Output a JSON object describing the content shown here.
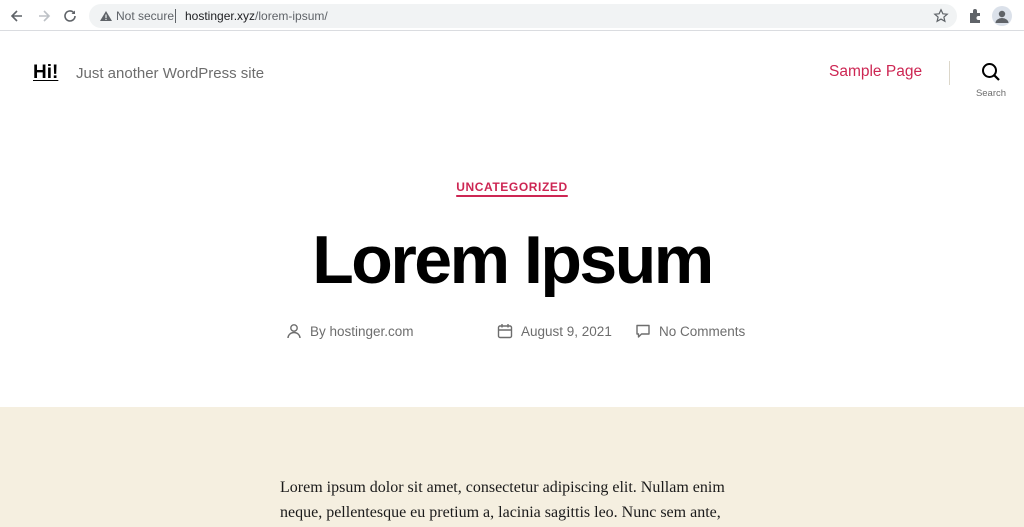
{
  "browser": {
    "security_label": "Not secure",
    "url_host": "hostinger.xyz",
    "url_path": "/lorem-ipsum/",
    "icons": [
      "back-icon",
      "forward-icon",
      "reload-icon",
      "warning-icon",
      "star-icon",
      "extensions-icon",
      "profile-icon"
    ]
  },
  "site": {
    "title": "Hi!",
    "tagline": "Just another WordPress site",
    "nav": [
      {
        "label": "Sample Page"
      }
    ],
    "search_label": "Search",
    "accent_color": "#cd2653"
  },
  "post": {
    "category": "UNCATEGORIZED",
    "title": "Lorem Ipsum",
    "meta": {
      "author": "By hostinger.com",
      "date": "August 9, 2021",
      "comments": "No Comments"
    },
    "body_lines": [
      "Lorem ipsum dolor sit amet, consectetur adipiscing elit. Nullam enim neque, pellentesque eu pretium a, lacinia sagittis leo. Nunc sem ante,"
    ],
    "content_background": "#f5efe0"
  }
}
